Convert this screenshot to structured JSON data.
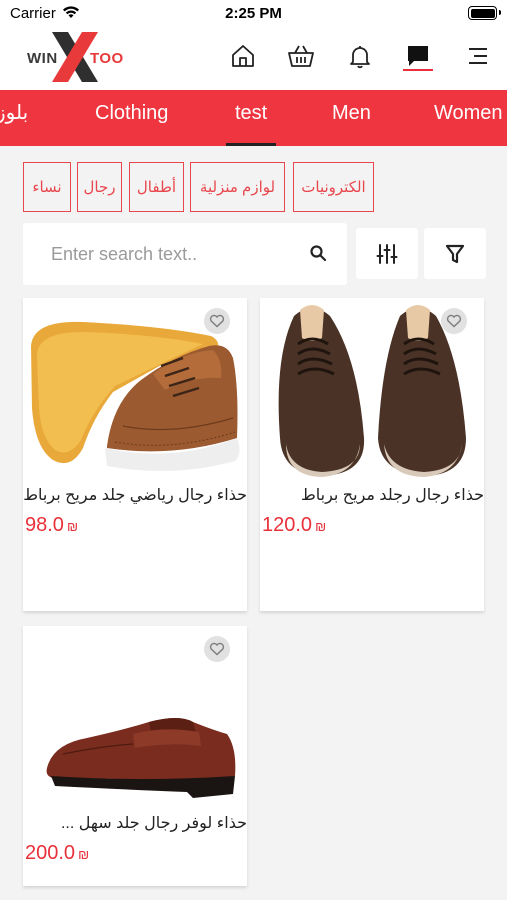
{
  "status": {
    "carrier": "Carrier",
    "time": "2:25 PM"
  },
  "logo": {
    "left": "WIN",
    "right": "TOO"
  },
  "tabs": [
    {
      "label": "بلوز"
    },
    {
      "label": "Clothing"
    },
    {
      "label": "test",
      "active": true
    },
    {
      "label": "Men"
    },
    {
      "label": "Women"
    }
  ],
  "chips": [
    {
      "label": "نساء"
    },
    {
      "label": "رجال"
    },
    {
      "label": "أطفال"
    },
    {
      "label": "لوازم منزلية"
    },
    {
      "label": "الكترونيات"
    }
  ],
  "search": {
    "placeholder": "Enter search text.."
  },
  "currency": "₪",
  "products": [
    {
      "name": "حذاء رجال رياضي جلد مريح برباط",
      "price": "98.0"
    },
    {
      "name": "حذاء رجال رجلد مريح برباط",
      "price": "120.0"
    },
    {
      "name": "حذاء لوفر رجال جلد سهل ...",
      "price": "200.0"
    }
  ],
  "colors": {
    "brand_red": "#ef3640",
    "price_red": "#e8313a",
    "chip_red": "#e8464d"
  },
  "icons": [
    "wifi-icon",
    "battery-icon",
    "home-icon",
    "basket-icon",
    "bell-icon",
    "chat-icon",
    "menu-icon",
    "search-icon",
    "sliders-icon",
    "filter-icon",
    "heart-icon"
  ]
}
